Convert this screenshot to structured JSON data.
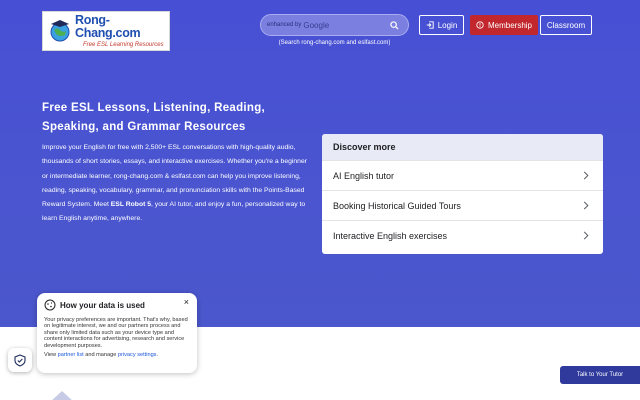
{
  "header": {
    "logo": {
      "name": "Rong-Chang.com",
      "tagline": "Free ESL Learning Resources"
    },
    "search": {
      "prefix": "enhanced by",
      "provider": "Google",
      "hint": "(Search rong-chang.com and eslfast.com)"
    },
    "login_label": "Login",
    "membership_label": "Membership",
    "classroom_label": "Classroom"
  },
  "hero": {
    "title": "Free ESL Lessons, Listening, Reading, Speaking, and Grammar Resources",
    "body_1": "Improve your English for free with 2,500+ ESL conversations with high-quality audio, thousands of short stories, essays, and interactive exercises. Whether you're a beginner or intermediate learner, rong-chang.com & eslfast.com can help you improve listening, reading, speaking, vocabulary, grammar, and pronunciation skills with the Points-Based Reward System. Meet",
    "body_bold": "ESL Robot 5",
    "body_2": ", your AI tutor, and enjoy a fun, personalized way to learn English anytime, anywhere."
  },
  "discover": {
    "title": "Discover more",
    "items": [
      "AI English tutor",
      "Booking Historical Guided Tours",
      "Interactive English exercises"
    ]
  },
  "privacy": {
    "title": "How your data is used",
    "text": "Your privacy preferences are important. That's why, based on legitimate interest, we and our partners process and share only limited data such as your device type and content interactions for advertising, research and service development purposes.",
    "foot_1": "View ",
    "partner_link": "partner list",
    "foot_2": " and manage ",
    "settings_link": "privacy settings",
    "foot_3": ".",
    "close": "×"
  },
  "tutor_button": "Talk to Your Tutor",
  "colors": {
    "hero": "#4750d4",
    "membership": "#c1272d",
    "tutor": "#2f3a9c"
  }
}
